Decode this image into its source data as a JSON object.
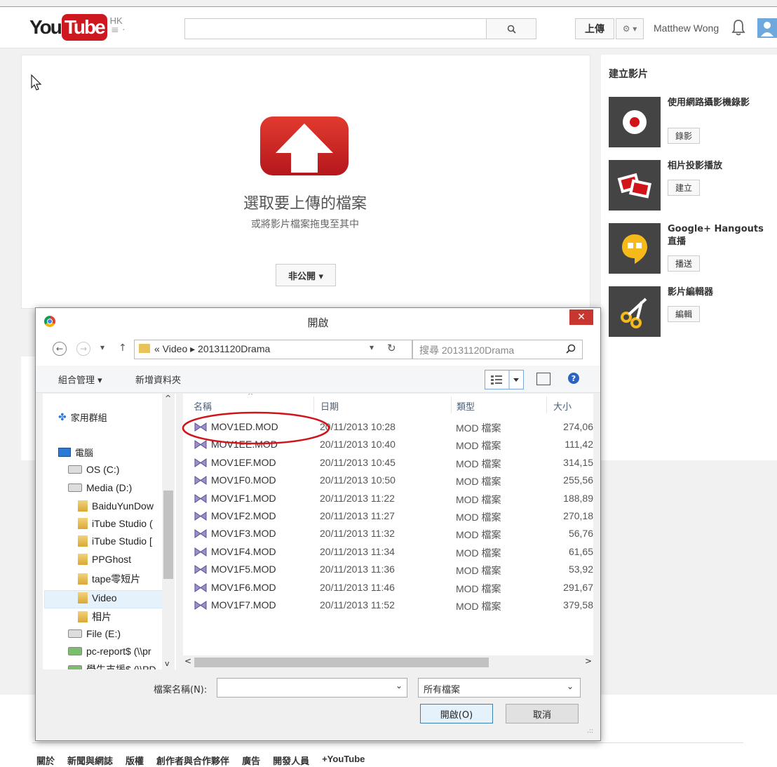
{
  "header": {
    "logo_you": "You",
    "logo_tube": "Tube",
    "logo_region": "HK",
    "guide_icon": "≡ ·",
    "upload_label": "上傳",
    "settings_label": "⚙ ▾",
    "username": "Matthew Wong"
  },
  "upload": {
    "select_text": "選取要上傳的檔案",
    "drag_text": "或將影片檔案拖曳至其中",
    "privacy_label": "非公開 ▾"
  },
  "sidebar": {
    "title": "建立影片",
    "items": [
      {
        "label": "使用網路攝影機錄影",
        "button": "錄影",
        "icon": "record-icon"
      },
      {
        "label": "相片投影播放",
        "button": "建立",
        "icon": "photos-icon"
      },
      {
        "label": "Google+ Hangouts 直播",
        "button": "播送",
        "icon": "hangouts-icon"
      },
      {
        "label": "影片編輯器",
        "button": "編輯",
        "icon": "scissors-icon"
      }
    ]
  },
  "footer": {
    "links": [
      "關於",
      "新聞與網誌",
      "版權",
      "創作者與合作夥伴",
      "廣告",
      "開發人員",
      "+YouTube"
    ]
  },
  "dialog": {
    "title": "開啟",
    "close_label": "✕",
    "path": "« Video ▸ 20131120Drama",
    "search_placeholder": "搜尋 20131120Drama",
    "organize_label": "組合管理 ▾",
    "new_folder_label": "新增資料夾",
    "columns": {
      "name": "名稱",
      "date": "日期",
      "type": "類型",
      "size": "大小"
    },
    "nav_tree": [
      {
        "label": "家用群組",
        "kind": "homegroup"
      },
      {
        "label": "電腦",
        "kind": "computer"
      },
      {
        "label": "OS (C:)",
        "kind": "drive"
      },
      {
        "label": "Media (D:)",
        "kind": "drive"
      },
      {
        "label": "BaiduYunDow",
        "kind": "folder"
      },
      {
        "label": "iTube Studio (",
        "kind": "folder"
      },
      {
        "label": "iTube Studio [",
        "kind": "folder"
      },
      {
        "label": "PPGhost",
        "kind": "folder"
      },
      {
        "label": "tape零短片",
        "kind": "folder"
      },
      {
        "label": "Video",
        "kind": "folder",
        "selected": true
      },
      {
        "label": "相片",
        "kind": "folder"
      },
      {
        "label": "File (E:)",
        "kind": "drive"
      },
      {
        "label": "pc-report$ (\\\\pr",
        "kind": "network"
      },
      {
        "label": "學生支援$ (\\\\PD",
        "kind": "network"
      }
    ],
    "files": [
      {
        "name": "MOV1ED.MOD",
        "date": "20/11/2013 10:28",
        "type": "MOD 檔案",
        "size": "274,06"
      },
      {
        "name": "MOV1EE.MOD",
        "date": "20/11/2013 10:40",
        "type": "MOD 檔案",
        "size": "111,42"
      },
      {
        "name": "MOV1EF.MOD",
        "date": "20/11/2013 10:45",
        "type": "MOD 檔案",
        "size": "314,15"
      },
      {
        "name": "MOV1F0.MOD",
        "date": "20/11/2013 10:50",
        "type": "MOD 檔案",
        "size": "255,56"
      },
      {
        "name": "MOV1F1.MOD",
        "date": "20/11/2013 11:22",
        "type": "MOD 檔案",
        "size": "188,89"
      },
      {
        "name": "MOV1F2.MOD",
        "date": "20/11/2013 11:27",
        "type": "MOD 檔案",
        "size": "270,18"
      },
      {
        "name": "MOV1F3.MOD",
        "date": "20/11/2013 11:32",
        "type": "MOD 檔案",
        "size": "56,76"
      },
      {
        "name": "MOV1F4.MOD",
        "date": "20/11/2013 11:34",
        "type": "MOD 檔案",
        "size": "61,65"
      },
      {
        "name": "MOV1F5.MOD",
        "date": "20/11/2013 11:36",
        "type": "MOD 檔案",
        "size": "53,92"
      },
      {
        "name": "MOV1F6.MOD",
        "date": "20/11/2013 11:46",
        "type": "MOD 檔案",
        "size": "291,67"
      },
      {
        "name": "MOV1F7.MOD",
        "date": "20/11/2013 11:52",
        "type": "MOD 檔案",
        "size": "379,58"
      }
    ],
    "filename_label": "檔案名稱(N):",
    "filename_value": "",
    "filter_label": "所有檔案",
    "open_label": "開啟(O)",
    "cancel_label": "取消"
  },
  "colors": {
    "youtube_red": "#cc181e",
    "close_red": "#c7372f",
    "highlight_ellipse": "#d0141a"
  }
}
